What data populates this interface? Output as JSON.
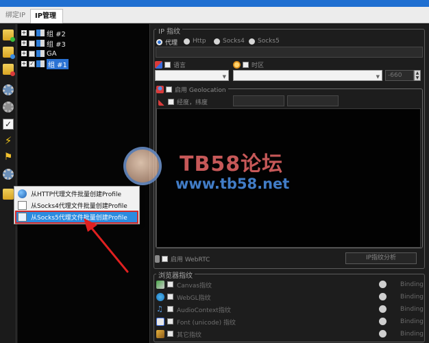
{
  "tabs": [
    {
      "label": "绑定IP",
      "active": false
    },
    {
      "label": "IP管理",
      "active": true
    }
  ],
  "toolbar": {
    "icons": [
      "folder-add-icon",
      "folder-edit-icon",
      "folder-delete-icon",
      "gear-icon",
      "gear-gray-icon",
      "checkbox-icon",
      "lightning-icon",
      "flag-icon",
      "gear-small-icon",
      "folder-export-icon"
    ]
  },
  "tree": {
    "nodes": [
      {
        "label": "组 #2",
        "checked": false,
        "selected": false
      },
      {
        "label": "组 #3",
        "checked": false,
        "selected": false
      },
      {
        "label": "GA",
        "checked": false,
        "selected": false
      },
      {
        "label": "组 #1",
        "checked": true,
        "selected": true
      }
    ]
  },
  "context_menu": {
    "items": [
      {
        "label": "从HTTP代理文件批量创建Profile",
        "icon": "globe-icon",
        "highlighted": false
      },
      {
        "label": "从Socks4代理文件批量创建Profile",
        "icon": "document-icon",
        "highlighted": false
      },
      {
        "label": "从Socks5代理文件批量创建Profile",
        "icon": "document-icon",
        "highlighted": true
      }
    ]
  },
  "ip_settings": {
    "title": "IP 指纹",
    "proxy_options": [
      "代理",
      "Http",
      "Socks4",
      "Socks5"
    ],
    "selected_proxy": "代理",
    "language_label": "语言",
    "timezone_label": "时区",
    "timezone_offset": "-660",
    "geolocation_label": "启用 Geolocation",
    "latlong_label": "经度，纬度",
    "webrtc_label": "启用 WebRTC",
    "ip_analysis_button": "IP指纹分析"
  },
  "browser_fingerprint": {
    "title": "浏览器指纹",
    "rows": [
      {
        "label": "Canvas指纹",
        "binding": "Binding"
      },
      {
        "label": "WebGL指纹",
        "binding": "Binding"
      },
      {
        "label": "AudioContext指纹",
        "binding": "Binding"
      },
      {
        "label": "Font (unicode) 指纹",
        "binding": "Binding"
      },
      {
        "label": "其它指纹",
        "binding": "Binding"
      }
    ]
  },
  "watermark": {
    "brand": "TB58论坛",
    "url": "www.tb58.net"
  }
}
